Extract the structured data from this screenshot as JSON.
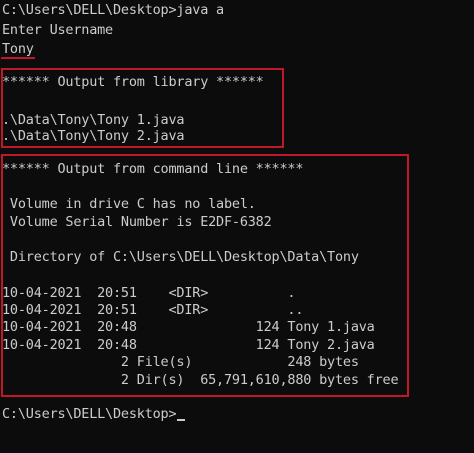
{
  "console": {
    "command_line": "C:\\Users\\DELL\\Desktop>java a",
    "prompt_line": "Enter Username",
    "username_input": "Tony",
    "library_header": "****** Output from library ******",
    "library_lines": [
      ".\\Data\\Tony\\Tony 1.java",
      ".\\Data\\Tony\\Tony 2.java"
    ],
    "cmd_header": "****** Output from command line ******",
    "volume_label": " Volume in drive C has no label.",
    "volume_serial": " Volume Serial Number is E2DF-6382",
    "directory_of": " Directory of C:\\Users\\DELL\\Desktop\\Data\\Tony",
    "dir_entries": [
      "10-04-2021  20:51    <DIR>          .",
      "10-04-2021  20:51    <DIR>          ..",
      "10-04-2021  20:48               124 Tony 1.java",
      "10-04-2021  20:48               124 Tony 2.java"
    ],
    "files_summary": "               2 File(s)            248 bytes",
    "dirs_summary": "               2 Dir(s)  65,791,610,880 bytes free",
    "final_prompt": "C:\\Users\\DELL\\Desktop>"
  },
  "colors": {
    "background": "#0c0c0c",
    "text": "#cccccc",
    "highlight": "#c0182a"
  }
}
